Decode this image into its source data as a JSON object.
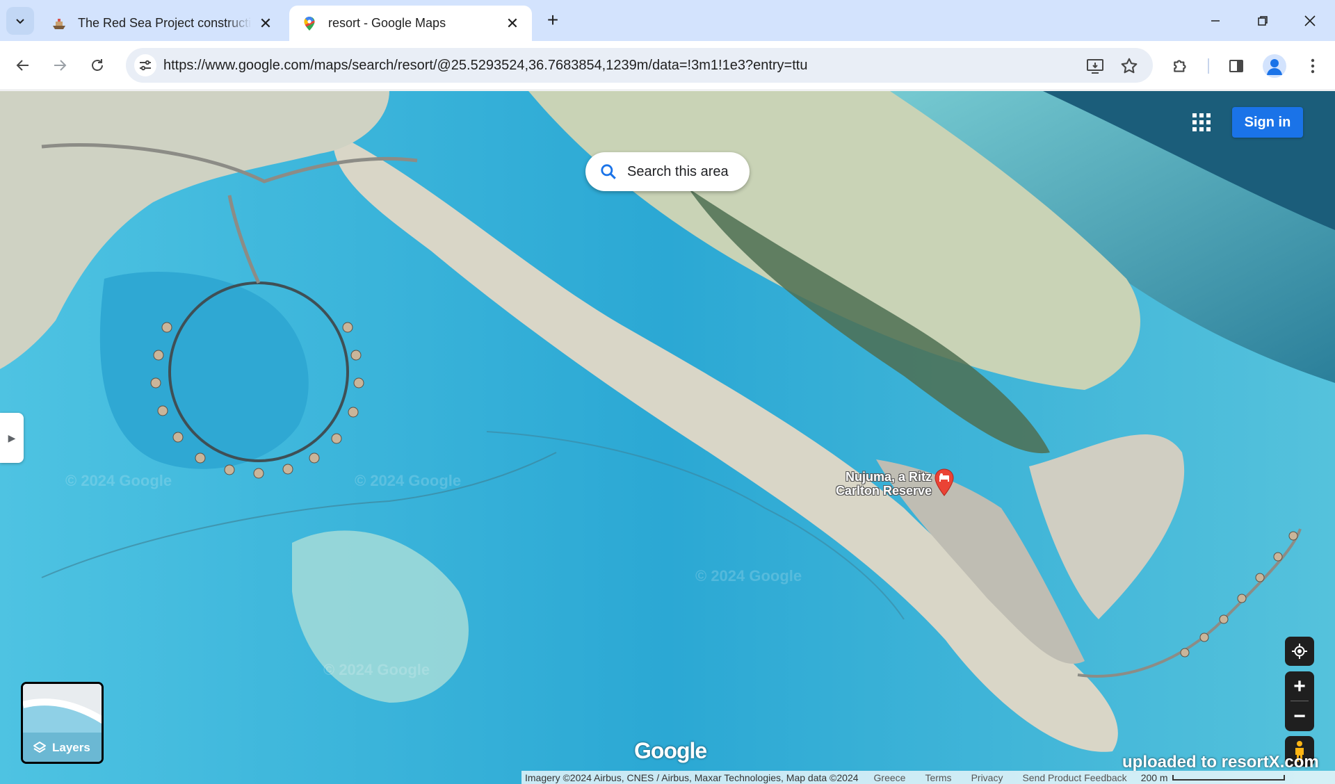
{
  "browser": {
    "tabs": [
      {
        "title": "The Red Sea Project construction",
        "active": false
      },
      {
        "title": "resort - Google Maps",
        "active": true
      }
    ],
    "url": "https://www.google.com/maps/search/resort/@25.5293524,36.7683854,1239m/data=!3m1!1e3?entry=ttu"
  },
  "map": {
    "sign_in": "Sign in",
    "search_area": "Search this area",
    "place": {
      "line1": "Nujuma, a Ritz",
      "line2": "Carlton Reserve"
    },
    "watermark": "© 2024 Google",
    "layers_label": "Layers",
    "zoom_in": "+",
    "zoom_out": "−",
    "logo": "Google",
    "uploaded_note": "uploaded to resortX.com",
    "attribution": {
      "imagery": "Imagery ©2024 Airbus, CNES / Airbus, Maxar Technologies, Map data ©2024",
      "region": "Greece",
      "terms": "Terms",
      "privacy": "Privacy",
      "feedback": "Send Product Feedback",
      "scale": "200 m"
    }
  },
  "colors": {
    "accent": "#1a73e8",
    "tab_strip": "#d3e3fd",
    "omnibox": "#e9eef6",
    "map_control": "#1f1f1f",
    "pin": "#ea4335"
  }
}
